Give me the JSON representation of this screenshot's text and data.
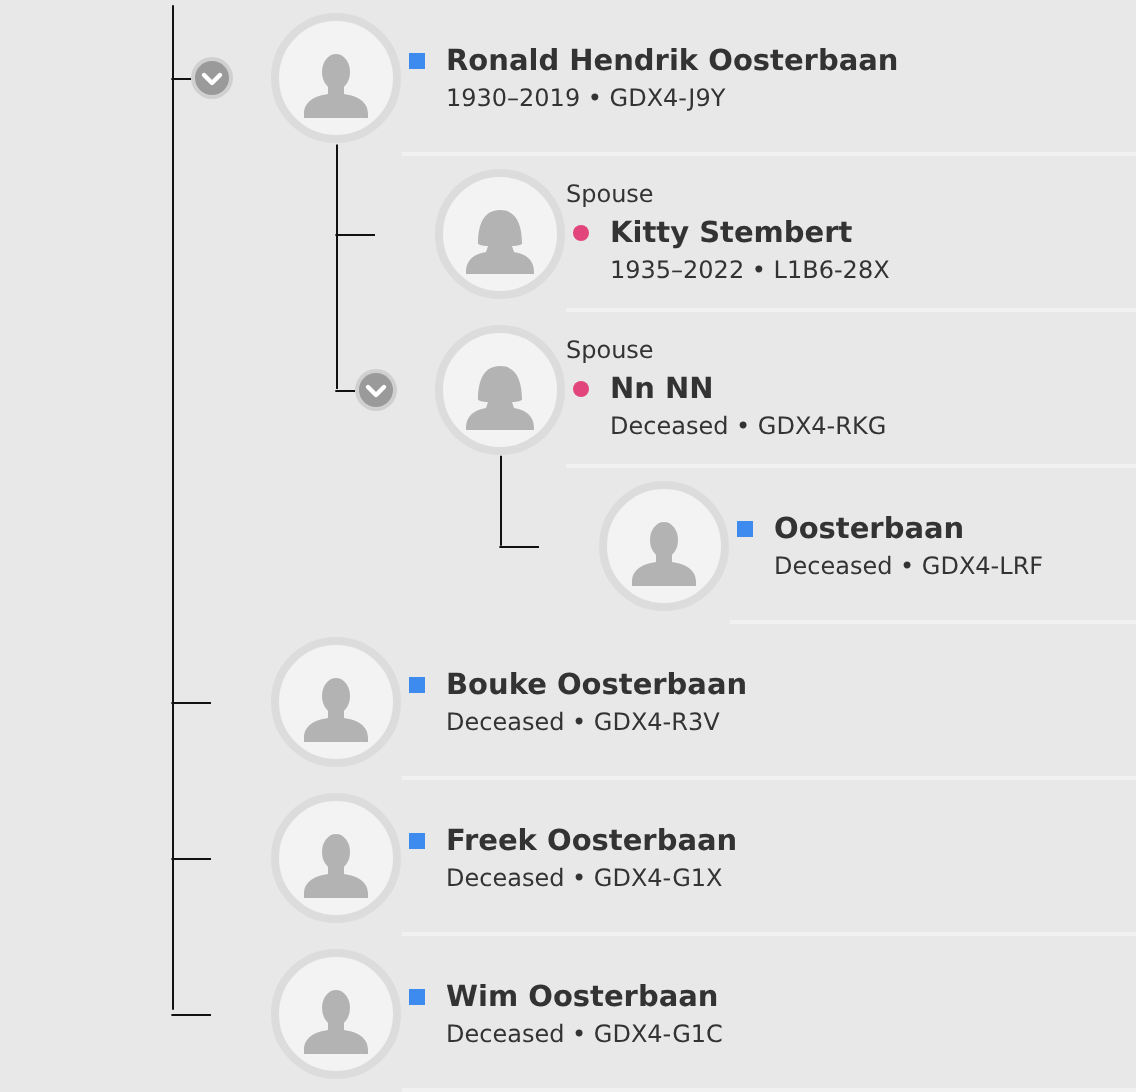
{
  "descendants": [
    {
      "name": "Ronald Hendrik Oosterbaan",
      "kind": "male",
      "details": "1930–2019 • GDX4-J9Y",
      "expanded": true,
      "spouses": [
        {
          "role": "Spouse",
          "name": "Kitty Stembert",
          "kind": "female",
          "details": "1935–2022 • L1B6-28X"
        },
        {
          "role": "Spouse",
          "name": "Nn NN",
          "kind": "female",
          "details": "Deceased • GDX4-RKG",
          "expanded": true,
          "children": [
            {
              "name": "Oosterbaan",
              "kind": "male",
              "details": "Deceased • GDX4-LRF"
            }
          ]
        }
      ]
    },
    {
      "name": "Bouke Oosterbaan",
      "kind": "male",
      "details": "Deceased • GDX4-R3V"
    },
    {
      "name": "Freek Oosterbaan",
      "kind": "male",
      "details": "Deceased • GDX4-G1X"
    },
    {
      "name": "Wim Oosterbaan",
      "kind": "male",
      "details": "Deceased • GDX4-G1C"
    }
  ]
}
